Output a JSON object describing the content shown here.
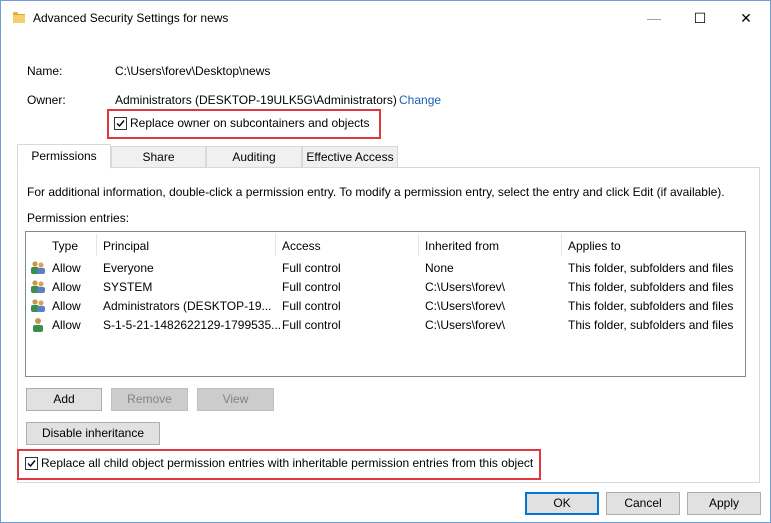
{
  "window": {
    "title": "Advanced Security Settings for news",
    "minimize_glyph": "—",
    "maximize_glyph": "☐",
    "close_glyph": "✕"
  },
  "info": {
    "name_label": "Name:",
    "name_value": "C:\\Users\\forev\\Desktop\\news",
    "owner_label": "Owner:",
    "owner_value": "Administrators (DESKTOP-19ULK5G\\Administrators)",
    "change_link": "Change",
    "replace_owner_label": "Replace owner on subcontainers and objects",
    "replace_owner_checked": true
  },
  "tabs": [
    {
      "label": "Permissions",
      "active": true
    },
    {
      "label": "Share",
      "active": false
    },
    {
      "label": "Auditing",
      "active": false
    },
    {
      "label": "Effective Access",
      "active": false
    }
  ],
  "permissions": {
    "info_text": "For additional information, double-click a permission entry. To modify a permission entry, select the entry and click Edit (if available).",
    "entries_label": "Permission entries:",
    "columns": [
      "Type",
      "Principal",
      "Access",
      "Inherited from",
      "Applies to"
    ],
    "rows": [
      {
        "icon": "group-users-icon",
        "type": "Allow",
        "principal": "Everyone",
        "access": "Full control",
        "inherited": "None",
        "applies": "This folder, subfolders and files"
      },
      {
        "icon": "group-users-icon",
        "type": "Allow",
        "principal": "SYSTEM",
        "access": "Full control",
        "inherited": "C:\\Users\\forev\\",
        "applies": "This folder, subfolders and files"
      },
      {
        "icon": "group-users-icon",
        "type": "Allow",
        "principal": "Administrators (DESKTOP-19...",
        "access": "Full control",
        "inherited": "C:\\Users\\forev\\",
        "applies": "This folder, subfolders and files"
      },
      {
        "icon": "single-user-icon",
        "type": "Allow",
        "principal": "S-1-5-21-1482622129-1799535...",
        "access": "Full control",
        "inherited": "C:\\Users\\forev\\",
        "applies": "This folder, subfolders and files"
      }
    ],
    "add_button": "Add",
    "remove_button": "Remove",
    "view_button": "View",
    "disable_inheritance_button": "Disable inheritance",
    "replace_child_label": "Replace all child object permission entries with inheritable permission entries from this object",
    "replace_child_checked": true
  },
  "footer": {
    "ok": "OK",
    "cancel": "Cancel",
    "apply": "Apply"
  },
  "colors": {
    "highlight_box": "#e0383e",
    "link": "#1a5fb4",
    "default_button_border": "#0078d7"
  }
}
